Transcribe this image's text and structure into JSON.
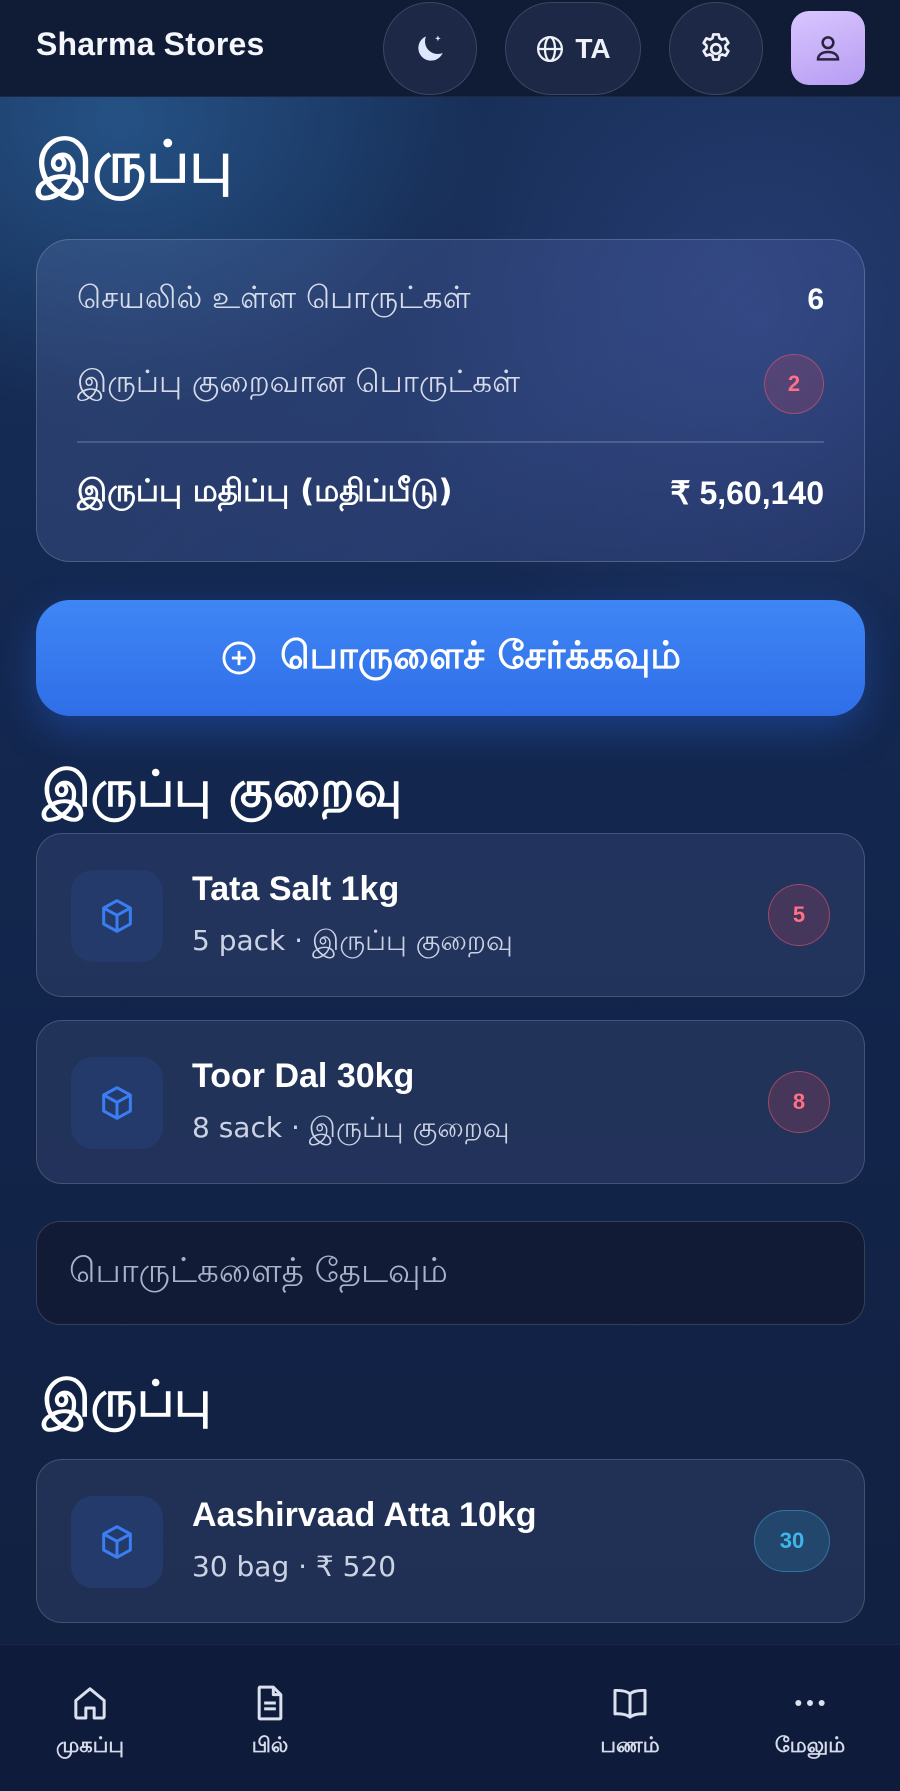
{
  "header": {
    "brand": "Sharma Stores",
    "language_label": "TA",
    "icons": {
      "theme": "moon-icon",
      "language": "globe-icon",
      "settings": "gear-icon",
      "profile": "user-icon"
    }
  },
  "page_title": "இருப்பு",
  "summary": {
    "active_items_label": "செயலில் உள்ள பொருட்கள்",
    "active_items_value": "6",
    "low_stock_label": "இருப்பு குறைவான பொருட்கள்",
    "low_stock_value": "2",
    "stock_value_label": "இருப்பு மதிப்பு (மதிப்பீடு)",
    "stock_value_amount": "₹ 5,60,140"
  },
  "add_button": {
    "label": "பொருளைச் சேர்க்கவும்",
    "icon": "plus-circle-icon"
  },
  "low_stock": {
    "title": "இருப்பு குறைவு",
    "items": [
      {
        "name": "Tata Salt 1kg",
        "sub": "5 pack · இருப்பு குறைவு",
        "count": "5"
      },
      {
        "name": "Toor Dal 30kg",
        "sub": "8 sack · இருப்பு குறைவு",
        "count": "8"
      }
    ]
  },
  "search": {
    "placeholder": "பொருட்களைத் தேடவும்"
  },
  "inventory": {
    "title": "இருப்பு",
    "items": [
      {
        "name": "Aashirvaad Atta 10kg",
        "sub": "30 bag · ₹ 520",
        "count": "30"
      }
    ]
  },
  "bottom_nav": {
    "items": [
      {
        "label": "முகப்பு",
        "icon": "home-icon"
      },
      {
        "label": "பில்",
        "icon": "document-icon"
      },
      {
        "label": "பணம்",
        "icon": "book-icon"
      },
      {
        "label": "மேலும்",
        "icon": "more-icon"
      }
    ]
  },
  "colors": {
    "accent": "#3A7EF2",
    "alert": "#FF6F86",
    "ok": "#3FB6EA",
    "background": "#142850"
  }
}
